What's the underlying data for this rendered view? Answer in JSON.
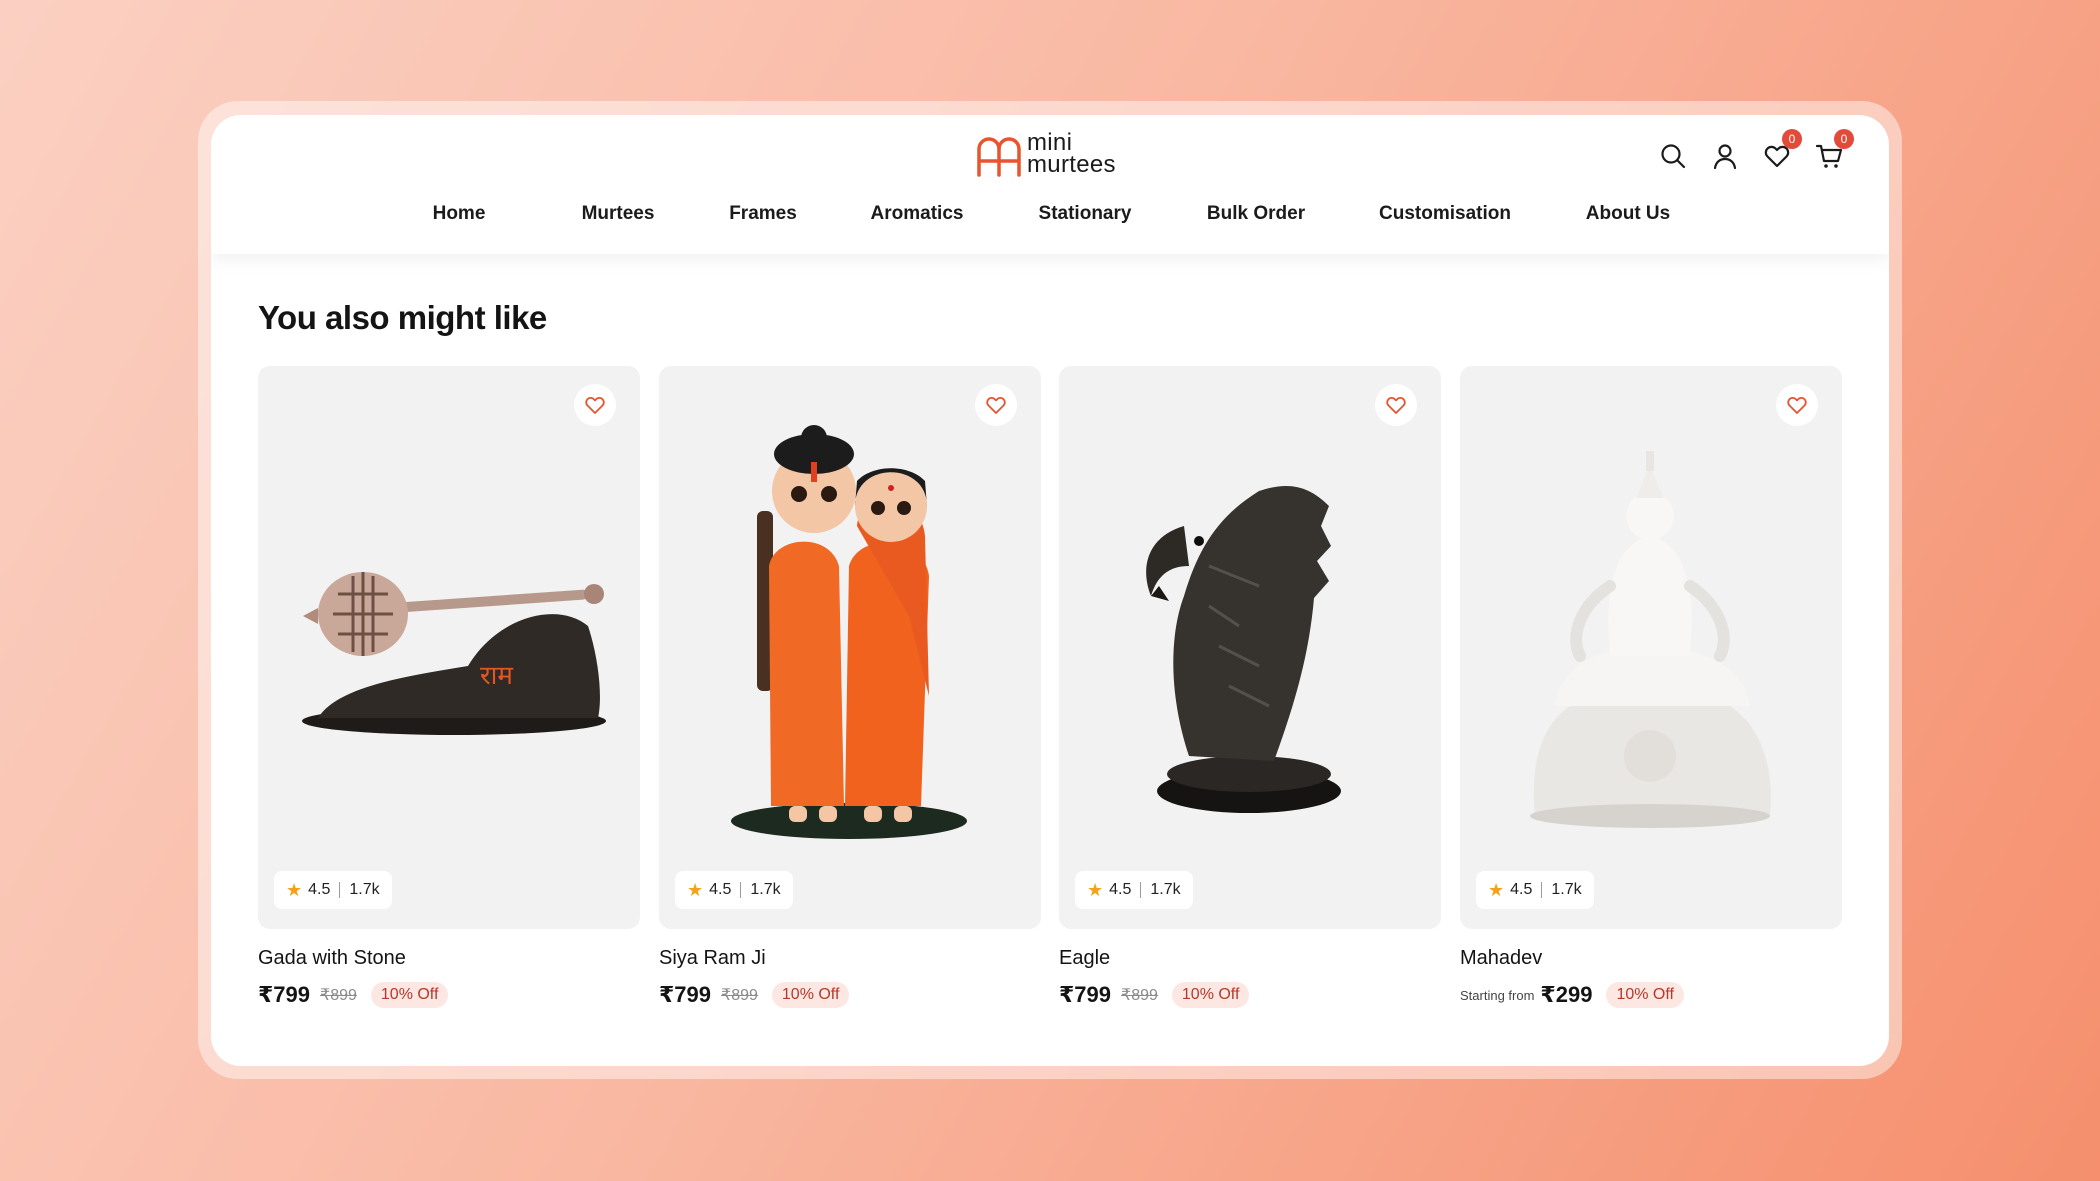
{
  "logo": {
    "line1": "mini",
    "line2": "murtees",
    "brand_color": "#e8542e"
  },
  "header": {
    "icons": [
      {
        "name": "search-icon",
        "badge": null
      },
      {
        "name": "user-icon",
        "badge": null
      },
      {
        "name": "heart-icon",
        "badge": "0"
      },
      {
        "name": "cart-icon",
        "badge": "0"
      }
    ]
  },
  "nav": {
    "items": [
      {
        "label": "Home"
      },
      {
        "label": "Murtees"
      },
      {
        "label": "Frames"
      },
      {
        "label": "Aromatics"
      },
      {
        "label": "Stationary"
      },
      {
        "label": "Bulk Order"
      },
      {
        "label": "Customisation"
      },
      {
        "label": "About Us"
      }
    ]
  },
  "section": {
    "title": "You also might like"
  },
  "products": [
    {
      "name": "Gada with Stone",
      "rating": "4.5",
      "reviews": "1.7k",
      "prefix": "",
      "price": "₹799",
      "old_price": "₹899",
      "discount": "10% Off",
      "icon": "gada-image"
    },
    {
      "name": "Siya Ram Ji",
      "rating": "4.5",
      "reviews": "1.7k",
      "prefix": "",
      "price": "₹799",
      "old_price": "₹899",
      "discount": "10% Off",
      "icon": "siya-ram-image"
    },
    {
      "name": "Eagle",
      "rating": "4.5",
      "reviews": "1.7k",
      "prefix": "",
      "price": "₹799",
      "old_price": "₹899",
      "discount": "10% Off",
      "icon": "eagle-image"
    },
    {
      "name": "Mahadev",
      "rating": "4.5",
      "reviews": "1.7k",
      "prefix": "Starting from",
      "price": "₹299",
      "old_price": "",
      "discount": "10% Off",
      "icon": "mahadev-image"
    }
  ],
  "colors": {
    "accent": "#e8542e",
    "discount_bg": "#fde7e2",
    "discount_text": "#b23a2a",
    "star": "#f3a21a",
    "card_bg": "#f2f2f2"
  }
}
